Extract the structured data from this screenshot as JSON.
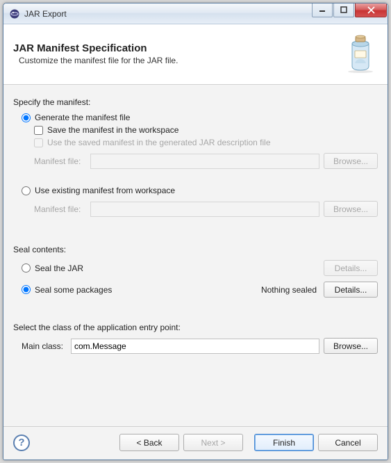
{
  "window": {
    "title": "JAR Export"
  },
  "header": {
    "title": "JAR Manifest Specification",
    "subtitle": "Customize the manifest file for the JAR file."
  },
  "manifest": {
    "section_label": "Specify the manifest:",
    "generate_label": "Generate the manifest file",
    "save_label": "Save the manifest in the workspace",
    "use_saved_label": "Use the saved manifest in the generated JAR description file",
    "manifest_file_label": "Manifest file:",
    "generate_value": "",
    "generate_browse": "Browse...",
    "use_existing_label": "Use existing manifest from workspace",
    "existing_value": "",
    "existing_browse": "Browse..."
  },
  "seal": {
    "section_label": "Seal contents:",
    "seal_jar_label": "Seal the JAR",
    "seal_jar_details": "Details...",
    "seal_some_label": "Seal some packages",
    "seal_some_status": "Nothing sealed",
    "seal_some_details": "Details..."
  },
  "mainclass": {
    "section_label": "Select the class of the application entry point:",
    "label": "Main class:",
    "value": "com.Message",
    "browse": "Browse..."
  },
  "buttons": {
    "back": "< Back",
    "next": "Next >",
    "finish": "Finish",
    "cancel": "Cancel"
  }
}
